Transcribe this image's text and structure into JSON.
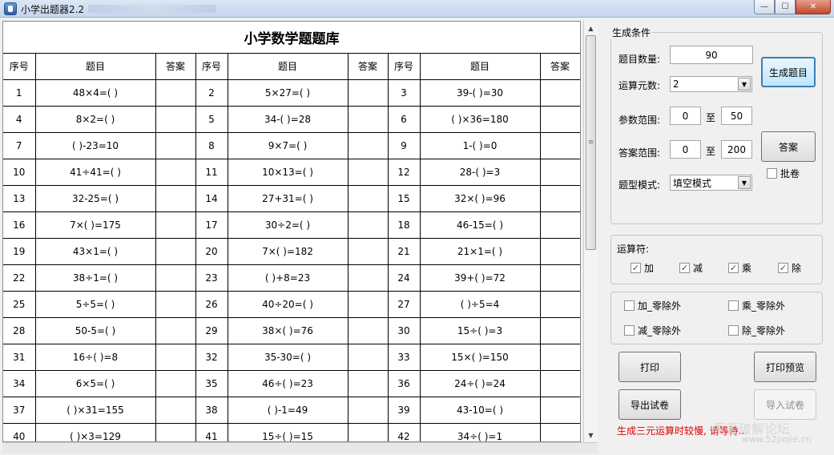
{
  "window": {
    "title": "小学出题器2.2",
    "min": "—",
    "max": "☐",
    "close": "✕"
  },
  "sheet": {
    "title": "小学数学题题库",
    "headers": [
      "序号",
      "题目",
      "答案",
      "序号",
      "题目",
      "答案",
      "序号",
      "题目",
      "答案"
    ],
    "rows": [
      [
        [
          "1",
          "48×4=(    )",
          ""
        ],
        [
          "2",
          "5×27=(    )",
          ""
        ],
        [
          "3",
          "39-(    )=30",
          ""
        ]
      ],
      [
        [
          "4",
          "8×2=(    )",
          ""
        ],
        [
          "5",
          "34-(    )=28",
          ""
        ],
        [
          "6",
          "(    )×36=180",
          ""
        ]
      ],
      [
        [
          "7",
          "(    )-23=10",
          ""
        ],
        [
          "8",
          "9×7=(    )",
          ""
        ],
        [
          "9",
          "1-(    )=0",
          ""
        ]
      ],
      [
        [
          "10",
          "41÷41=(    )",
          ""
        ],
        [
          "11",
          "10×13=(    )",
          ""
        ],
        [
          "12",
          "28-(    )=3",
          ""
        ]
      ],
      [
        [
          "13",
          "32-25=(    )",
          ""
        ],
        [
          "14",
          "27+31=(    )",
          ""
        ],
        [
          "15",
          "32×(    )=96",
          ""
        ]
      ],
      [
        [
          "16",
          "7×(    )=175",
          ""
        ],
        [
          "17",
          "30÷2=(    )",
          ""
        ],
        [
          "18",
          "46-15=(    )",
          ""
        ]
      ],
      [
        [
          "19",
          "43×1=(    )",
          ""
        ],
        [
          "20",
          "7×(    )=182",
          ""
        ],
        [
          "21",
          "21×1=(    )",
          ""
        ]
      ],
      [
        [
          "22",
          "38÷1=(    )",
          ""
        ],
        [
          "23",
          "(    )+8=23",
          ""
        ],
        [
          "24",
          "39+(    )=72",
          ""
        ]
      ],
      [
        [
          "25",
          "5÷5=(    )",
          ""
        ],
        [
          "26",
          "40÷20=(    )",
          ""
        ],
        [
          "27",
          "(    )÷5=4",
          ""
        ]
      ],
      [
        [
          "28",
          "50-5=(    )",
          ""
        ],
        [
          "29",
          "38×(    )=76",
          ""
        ],
        [
          "30",
          "15÷(    )=3",
          ""
        ]
      ],
      [
        [
          "31",
          "16÷(    )=8",
          ""
        ],
        [
          "32",
          "35-30=(    )",
          ""
        ],
        [
          "33",
          "15×(    )=150",
          ""
        ]
      ],
      [
        [
          "34",
          "6×5=(    )",
          ""
        ],
        [
          "35",
          "46÷(    )=23",
          ""
        ],
        [
          "36",
          "24÷(    )=24",
          ""
        ]
      ],
      [
        [
          "37",
          "(    )×31=155",
          ""
        ],
        [
          "38",
          "(    )-1=49",
          ""
        ],
        [
          "39",
          "43-10=(    )",
          ""
        ]
      ],
      [
        [
          "40",
          "(    )×3=129",
          ""
        ],
        [
          "41",
          "15÷(    )=15",
          ""
        ],
        [
          "42",
          "34÷(    )=1",
          ""
        ]
      ]
    ]
  },
  "conditions": {
    "legend": "生成条件",
    "count_label": "题目数量:",
    "count_value": "90",
    "operands_label": "运算元数:",
    "operands_value": "2",
    "param_label": "参数范围:",
    "param_min": "0",
    "param_to": "至",
    "param_max": "50",
    "answer_label": "答案范围:",
    "answer_min": "0",
    "answer_to": "至",
    "answer_max": "200",
    "mode_label": "题型模式:",
    "mode_value": "填空模式",
    "generate_button": "生成题目",
    "answer_button": "答案",
    "grade_label": "批卷"
  },
  "operators": {
    "legend": "运算符:",
    "items": [
      {
        "label": "加",
        "checked": true
      },
      {
        "label": "减",
        "checked": true
      },
      {
        "label": "乘",
        "checked": true
      },
      {
        "label": "除",
        "checked": true
      }
    ]
  },
  "zero_options": {
    "add": "加_零除外",
    "mul": "乘_零除外",
    "sub": "减_零除外",
    "div": "除_零除外"
  },
  "actions": {
    "print": "打印",
    "print_preview": "打印预览",
    "export": "导出试卷",
    "import": "导入试卷"
  },
  "note": "生成三元运算时较慢, 请等待...",
  "watermark": {
    "text": "吾爱破解论坛",
    "url": "www.52pojie.cn"
  }
}
